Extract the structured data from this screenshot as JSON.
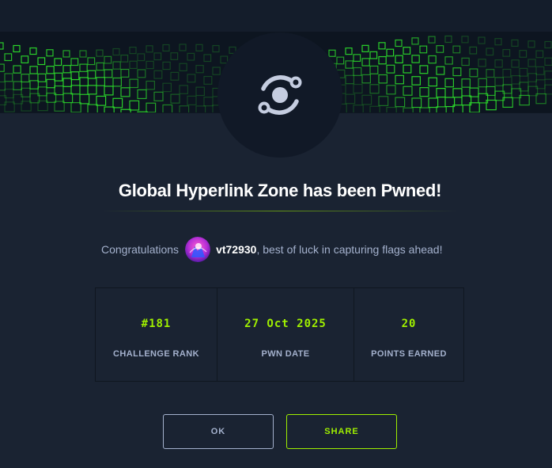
{
  "header": {
    "title": "Global Hyperlink Zone has been Pwned!"
  },
  "congrats": {
    "prefix": "Congratulations",
    "username": "vt72930",
    "suffix": ", best of luck in capturing flags ahead!"
  },
  "stats": [
    {
      "value": "#181",
      "label": "CHALLENGE RANK"
    },
    {
      "value": "27 Oct 2025",
      "label": "PWN DATE"
    },
    {
      "value": "20",
      "label": "POINTS EARNED"
    }
  ],
  "actions": {
    "ok_label": "OK",
    "share_label": "SHARE"
  },
  "icons": {
    "badge": "orbit-icon",
    "avatar": "user-avatar"
  },
  "colors": {
    "background": "#1a2332",
    "accent": "#9fef00",
    "muted_text": "#a4b1cd",
    "badge_bg": "#111927"
  }
}
